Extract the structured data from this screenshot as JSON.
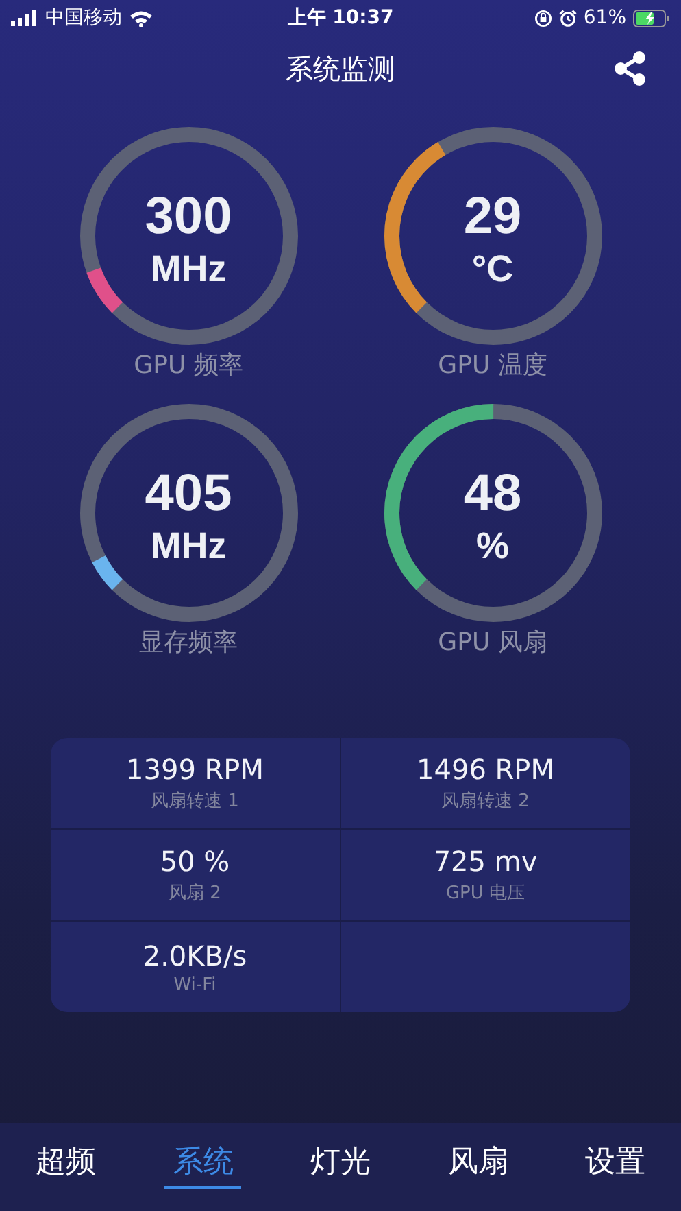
{
  "status_bar": {
    "carrier": "中国移动",
    "time": "上午 10:37",
    "battery": "61%"
  },
  "header": {
    "title": "系统监测"
  },
  "gauges": [
    {
      "value": "300",
      "unit": "MHz",
      "label": "GPU 频率",
      "level": 0.07,
      "color": "#e0508a"
    },
    {
      "value": "29",
      "unit": "°C",
      "label": "GPU 温度",
      "level": 0.29,
      "color": "#d88a34"
    },
    {
      "value": "405",
      "unit": "MHz",
      "label": "显存频率",
      "level": 0.05,
      "color": "#6ab4ee"
    },
    {
      "value": "48",
      "unit": "%",
      "label": "GPU 风扇",
      "level": 0.375,
      "color": "#48b07c"
    }
  ],
  "stats": [
    {
      "value": "1399 RPM",
      "label": "风扇转速 1"
    },
    {
      "value": "1496 RPM",
      "label": "风扇转速 2"
    },
    {
      "value": "50 %",
      "label": "风扇 2"
    },
    {
      "value": "725 mv",
      "label": "GPU 电压"
    },
    {
      "value": "2.0KB/s",
      "label": "Wi-Fi"
    }
  ],
  "tabs": [
    {
      "label": "超频",
      "selected": false
    },
    {
      "label": "系统",
      "selected": true
    },
    {
      "label": "灯光",
      "selected": false
    },
    {
      "label": "风扇",
      "selected": false
    },
    {
      "label": "设置",
      "selected": false
    }
  ]
}
